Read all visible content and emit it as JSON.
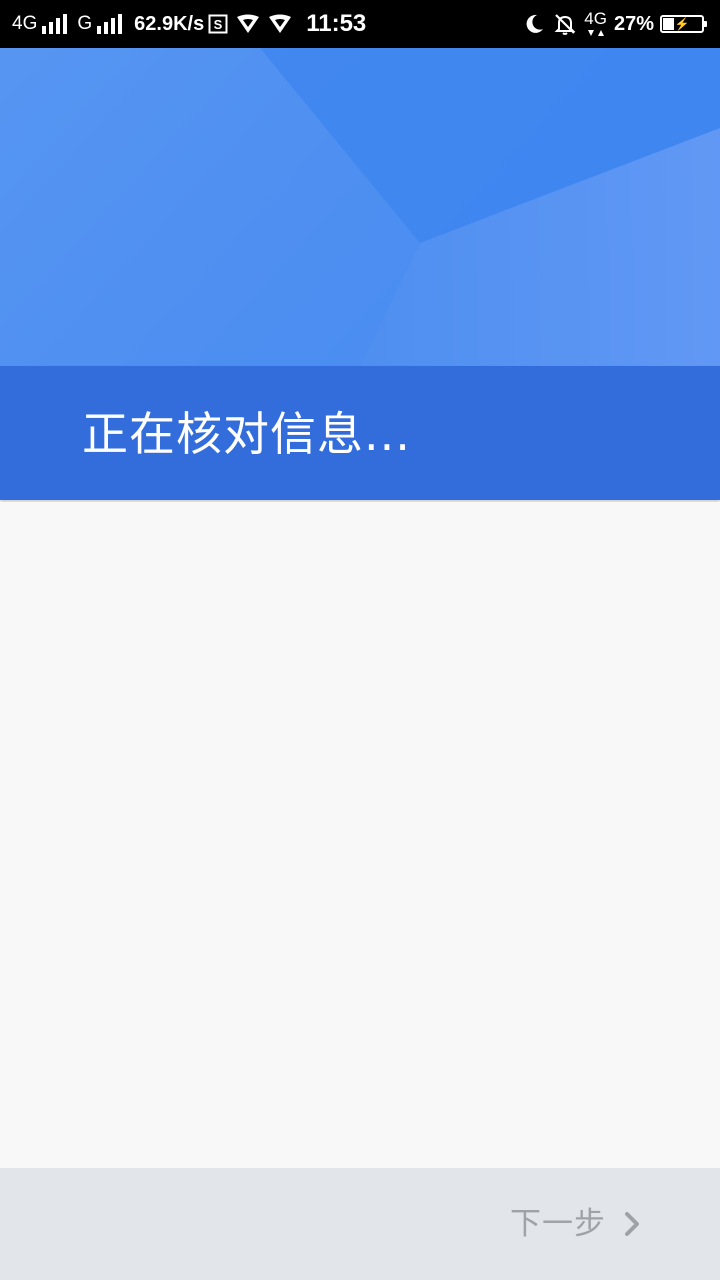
{
  "status_bar": {
    "network_1": "4G",
    "network_2": "G",
    "speed": "62.9K/s",
    "time": "11:53",
    "data_type": "4G",
    "battery_percent": "27%",
    "battery_level": 0.27,
    "icons": [
      "signal-bars-icon",
      "signal-bars-icon",
      "s-box-icon",
      "vpn-shield-icon",
      "vpn-shield-icon",
      "moon-icon",
      "bell-off-icon",
      "data-arrows-icon",
      "battery-charging-icon"
    ]
  },
  "header": {
    "title": "正在核对信息...",
    "colors": {
      "background": "#4f8ff0",
      "band": "#336ddb"
    }
  },
  "footer": {
    "next_label": "下一步",
    "next_icon": "chevron-right-icon",
    "next_color": "#9ea3a8"
  }
}
